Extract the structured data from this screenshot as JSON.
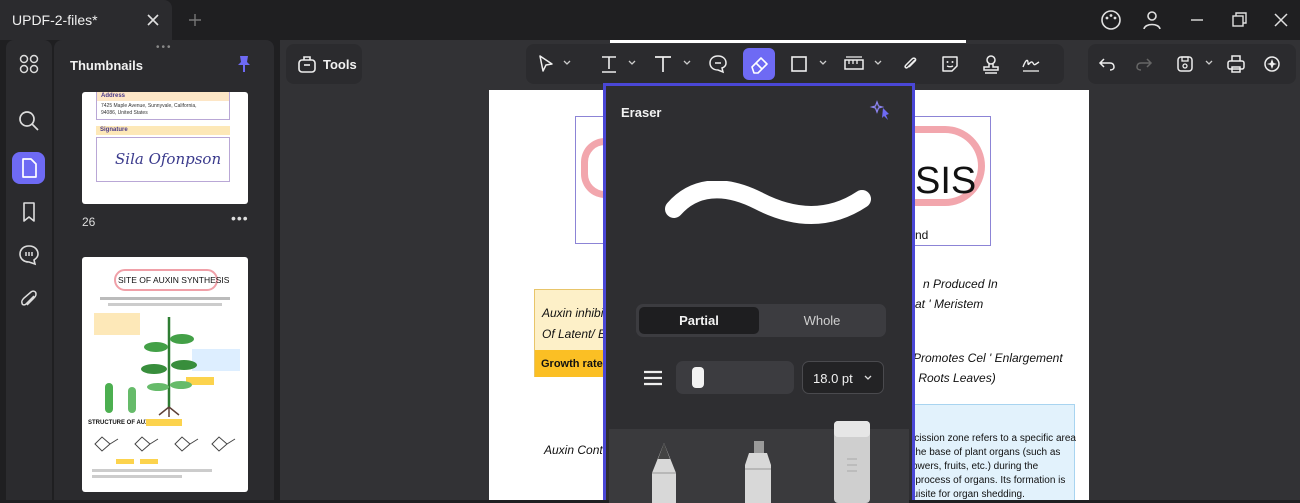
{
  "titlebar": {
    "tab_title": "UPDF-2-files*",
    "icons": [
      "close-icon",
      "plus-icon",
      "palette-icon",
      "user-icon",
      "restore-icon",
      "close-window-icon"
    ]
  },
  "sidebar": {
    "rail_icons": [
      "grid-icon",
      "search-icon",
      "pages-icon",
      "bookmark-icon",
      "comment-icon",
      "attachment-icon"
    ],
    "active": "pages-icon"
  },
  "thumbnails": {
    "title": "Thumbnails",
    "page1": {
      "address_label": "Address",
      "address_line1": "7425 Maple Avenue, Sunnyvale, California,",
      "address_line2": "94086, United States",
      "signature_label": "Signature",
      "signature": "Sila Ofonpson"
    },
    "page_number": "26",
    "page2": {
      "title": "SITE OF AUXIN SYNTHESIS",
      "structure_label": "STRUCTURE OF AUXIN"
    }
  },
  "toolbar": {
    "tools_label": "Tools",
    "active_tool": "eraser-icon"
  },
  "document": {
    "heading_fragment": "SIS",
    "subfragment": "nd",
    "line1": "n Produced In",
    "line2": "at ' Meristem",
    "sticky1": "Auxin inhibit",
    "sticky2": "Of Latent/ B",
    "growth": "Growth rate sl",
    "line3": "Promotes Cel ' Enlargement",
    "line4": "s Roots Leaves)",
    "line5": "Auxin Contr",
    "box_lines": [
      "iscission zone refers to a specific area",
      "t the base of plant organs (such as",
      "flowers, fruits, etc.) during the",
      "g process of organs. Its formation is",
      "quisite for organ shedding."
    ]
  },
  "eraser_panel": {
    "title": "Eraser",
    "mode_partial": "Partial",
    "mode_whole": "Whole",
    "size": "18.0 pt",
    "size_fraction": 0.12,
    "colors": {
      "accent": "#6e6af4",
      "border": "#4a47d6"
    }
  }
}
